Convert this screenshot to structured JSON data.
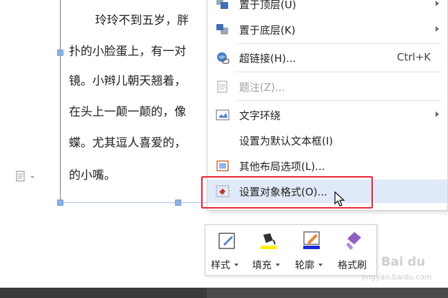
{
  "document": {
    "paragraph_lines": [
      "玲玲不到五岁，胖",
      "扑的小脸蛋上，有一对",
      "镜。小辫儿朝天翘着，",
      "在头上一颠一颠的，像",
      "蝶。尤其逗人喜爱的，",
      "的小嘴。"
    ]
  },
  "context_menu": {
    "items": [
      {
        "label": "置于顶层(U)",
        "icon": "bring-to-front-icon",
        "submenu": true
      },
      {
        "label": "置于底层(K)",
        "icon": "send-to-back-icon",
        "submenu": true
      },
      {
        "label": "超链接(H)...",
        "icon": "hyperlink-icon",
        "shortcut": "Ctrl+K"
      },
      {
        "label": "题注(Z)...",
        "icon": "caption-icon",
        "disabled": true
      },
      {
        "label": "文字环绕",
        "icon": "text-wrap-icon",
        "submenu": true
      },
      {
        "label": "设置为默认文本框(I)"
      },
      {
        "label": "其他布局选项(L)...",
        "icon": "layout-options-icon"
      },
      {
        "label": "设置对象格式(O)...",
        "icon": "format-object-icon",
        "highlighted": true
      }
    ]
  },
  "mini_toolbar": {
    "tools": [
      {
        "label": "样式",
        "icon": "style-brush-icon"
      },
      {
        "label": "填充",
        "icon": "fill-bucket-icon",
        "color": "#ffee00"
      },
      {
        "label": "轮廓",
        "icon": "outline-pen-icon",
        "color": "#1a2bd6"
      },
      {
        "label": "格式刷",
        "icon": "format-painter-icon"
      }
    ]
  },
  "watermark": {
    "brand": "Bai du",
    "url": "jingyan.baidu.com"
  },
  "colors": {
    "highlight": "#dfe9f8",
    "annotation_red": "#e4232f",
    "selection_handle": "#8fb1e3"
  }
}
